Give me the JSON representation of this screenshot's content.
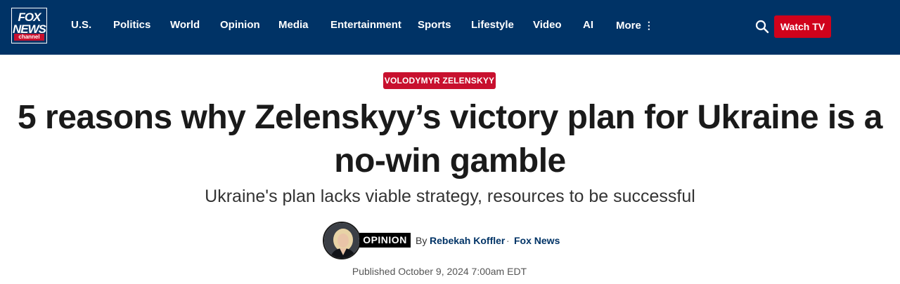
{
  "brand": {
    "logo_line1": "FOX",
    "logo_line2": "NEWS",
    "logo_line3": "channel",
    "colors": {
      "header_bg": "#003366",
      "accent_red": "#c8102e",
      "button_red": "#d0021b"
    }
  },
  "nav": {
    "items": [
      "U.S.",
      "Politics",
      "World",
      "Opinion",
      "Media",
      "Entertainment",
      "Sports",
      "Lifestyle",
      "Video",
      "AI",
      "More"
    ],
    "more_icon": "vertical-dots-icon"
  },
  "header_actions": {
    "search_icon": "search-icon",
    "watch_label": "Watch TV"
  },
  "article": {
    "tag": "VOLODYMYR ZELENSKYY",
    "headline_line1": "5 reasons why Zelenskyy’s victory plan for Ukraine is a",
    "headline_line2": "no-win gamble",
    "subhead": "Ukraine's plan lacks viable strategy, resources to be successful",
    "badge": "OPINION",
    "by": "By",
    "author": "Rebekah Koffler",
    "separator": "·",
    "outlet": "Fox News",
    "published": "Published October 9, 2024 7:00am EDT"
  }
}
